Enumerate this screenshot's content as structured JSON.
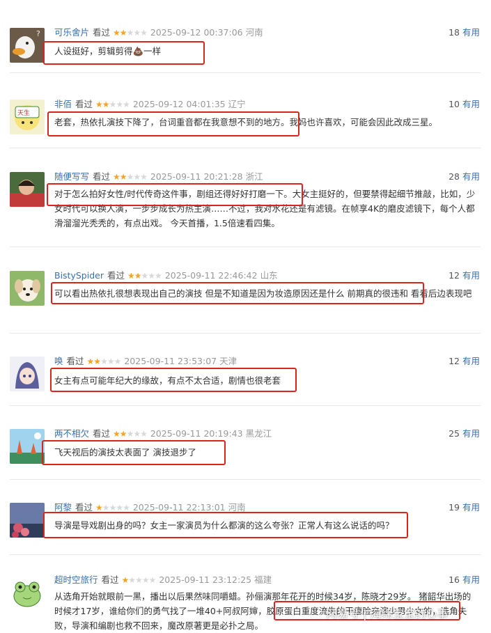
{
  "comments": [
    {
      "user": "可乐舍片",
      "status": "看过",
      "rating": 2,
      "time": "2025-09-12 00:37:06",
      "location": "河南",
      "useful_count": "18",
      "useful_label": "有用",
      "text": "人设挺好，剪辑剪得💩一样",
      "avatar_icon": "goose-avatar-icon"
    },
    {
      "user": "非佰",
      "status": "看过",
      "rating": 2,
      "time": "2025-09-12 04:01:35",
      "location": "辽宁",
      "useful_count": "10",
      "useful_label": "有用",
      "text": "老套，热依扎演技下降了，台词重音都在我意想不到的地方。我妈也许喜欢，可能会因此改成三星。",
      "avatar_icon": "cartoon-avatar-icon"
    },
    {
      "user": "随便写写",
      "status": "看过",
      "rating": 2,
      "time": "2025-09-11 20:21:28",
      "location": "浙江",
      "useful_count": "28",
      "useful_label": "有用",
      "text": "对于怎么拍好女性/时代传奇这件事，剧组还得好好打磨一下。大女主挺好的，但要禁得起细节推敲，比如，少女时代可以换人演，一步步成长为热主演……不过，我对水花还是有滤镜。在帧享4K的磨皮滤镜下，每个人都滑溜溜光秃秃的，有点出戏。 今天首播，1.5倍速看四集。",
      "avatar_icon": "photo-avatar-icon"
    },
    {
      "user": "BistySpider",
      "status": "看过",
      "rating": 2,
      "time": "2025-09-11 22:46:42",
      "location": "山东",
      "useful_count": "12",
      "useful_label": "有用",
      "text": "可以看出热依扎很想表现出自己的演技 但是不知道是因为妆造原因还是什么 前期真的很违和 看看后边表现吧",
      "avatar_icon": "dog-avatar-icon"
    },
    {
      "user": "唤",
      "status": "看过",
      "rating": 2,
      "time": "2025-09-11 23:53:07",
      "location": "天津",
      "useful_count": "12",
      "useful_label": "有用",
      "text": "女主有点可能年纪大的缘故，有点不太合适，剧情也很老套",
      "avatar_icon": "anime-girl-avatar-icon"
    },
    {
      "user": "两不相欠",
      "status": "看过",
      "rating": 2,
      "time": "2025-09-11 20:19:43",
      "location": "黑龙江",
      "useful_count": "25",
      "useful_label": "有用",
      "text": "飞天视后的演技太表面了 演技退步了",
      "avatar_icon": "sky-avatar-icon"
    },
    {
      "user": "阿黎",
      "status": "看过",
      "rating": 1,
      "time": "2025-09-11 22:13:01",
      "location": "河南",
      "useful_count": "19",
      "useful_label": "有用",
      "text": "导演是导戏剧出身的吗？女主一家演员为什么都演的这么夸张？正常人有这么说话的吗？",
      "avatar_icon": "flower-avatar-icon"
    },
    {
      "user": "超时空旅行",
      "status": "看过",
      "rating": 1,
      "time": "2025-09-11 23:12:25",
      "location": "福建",
      "useful_count": "16",
      "useful_label": "有用",
      "text": "从选角开始就眼前一黑，播出以后果然味同嚼蜡。孙俪演那年花开的时候34岁，陈晓才29岁。 猪韶华出场的时候才17岁，谁给你们的勇气找了一堆40+阿叔阿婶，胶原蛋白重度流失的干瘪脸来演少男少女的，选角失败，导演和编剧也救不回来，魔改原著更是必扑之局。",
      "avatar_icon": "frog-avatar-icon"
    }
  ],
  "watermark": "网易号 | 海绵宝宝的心事",
  "colors": {
    "highlight": "#d9251b",
    "username": "#3a6fb0",
    "star": "#f3a428"
  }
}
